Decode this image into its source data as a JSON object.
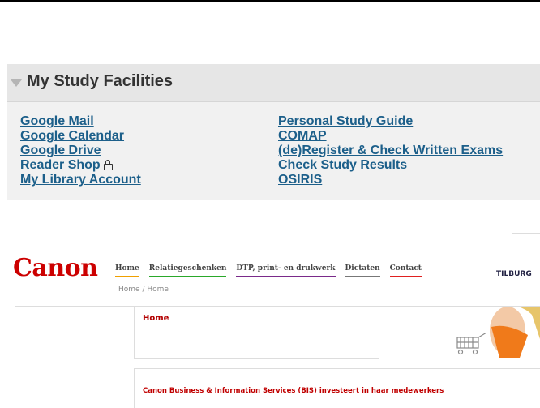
{
  "study": {
    "title": "My Study Facilities",
    "left_links": [
      "Google Mail",
      "Google Calendar",
      "Google Drive",
      "Reader Shop",
      "My Library Account"
    ],
    "right_links": [
      "Personal Study Guide",
      "COMAP",
      "(de)Register & Check Written Exams",
      "Check Study Results",
      "OSIRIS"
    ]
  },
  "canon": {
    "logo": "Canon",
    "nav": [
      {
        "label": "Home",
        "color": "#f0a000"
      },
      {
        "label": "Relatiegeschenken",
        "color": "#2aa82a"
      },
      {
        "label": "DTP, print- en drukwerk",
        "color": "#7a2a8a"
      },
      {
        "label": "Dictaten",
        "color": "#777777"
      },
      {
        "label": "Contact",
        "color": "#e02020"
      }
    ],
    "breadcrumb": "Home / Home",
    "location": "TILBURG",
    "page_title": "Home",
    "headline": "Canon Business & Information Services (BIS) investeert in haar medewerkers"
  }
}
